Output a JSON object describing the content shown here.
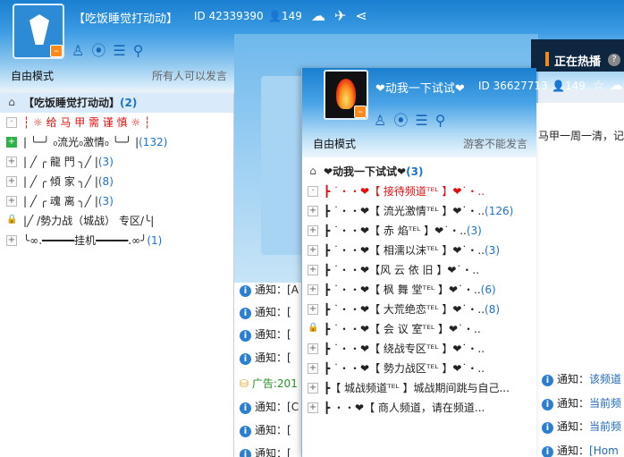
{
  "bg_channel": {
    "title": "【吃饭睡觉打动动】",
    "id_text": "ID 42339390",
    "member_count": "149",
    "mode_label": "自由模式",
    "speak_note": "所有人可以发言",
    "channels": [
      {
        "label": "【吃饭睡觉打动动】",
        "count": "(2)",
        "icon": "home",
        "style": "sel bold"
      },
      {
        "label": "┆ ☼  给 马 甲 需 谨 慎  ☼ ┆",
        "count": "",
        "icon": "dot",
        "style": "red"
      },
      {
        "label": "| ╰─╯ ₀流光₀激情₀ ╰─╯ |",
        "count": "(132)",
        "icon": "green",
        "style": ""
      },
      {
        "label": "| ╱ ╭ 龍        門 ╮╱  |",
        "count": "(3)",
        "icon": "plus",
        "style": ""
      },
      {
        "label": "| ╱ ╭ 傾        家 ╮╱  |",
        "count": "(8)",
        "icon": "plus",
        "style": ""
      },
      {
        "label": "| ╱ ╭ 魂        离 ╮╱  |",
        "count": "(3)",
        "icon": "plus",
        "style": ""
      },
      {
        "label": "|╱ /勢力战（城战） 专区/╰|",
        "count": "",
        "icon": "lock",
        "style": ""
      },
      {
        "label": "╰∞.━━━━━挂机━━━━━.∞╯",
        "count": "(1)",
        "icon": "plus",
        "style": ""
      }
    ],
    "chat_lines": [
      {
        "prefix": "通知：",
        "text": "[A"
      },
      {
        "prefix": "通知：",
        "text": "["
      },
      {
        "prefix": "通知：",
        "text": "["
      },
      {
        "prefix": "通知：",
        "text": "["
      },
      {
        "prefix": "广告:",
        "text": "201"
      },
      {
        "prefix": "通知：",
        "text": "[C"
      },
      {
        "prefix": "通知：",
        "text": "["
      },
      {
        "prefix": "通知：",
        "text": "["
      }
    ],
    "hot_label": "正在热播",
    "hot_help": "?",
    "right_text": "马甲一周一清，记",
    "right_lines": [
      {
        "prefix": "通知：",
        "text": "该频道"
      },
      {
        "prefix": "通知：",
        "text": "当前频"
      },
      {
        "prefix": "通知：",
        "text": "当前频"
      },
      {
        "prefix": "通知：",
        "text": "[Hom"
      }
    ]
  },
  "fg_channel": {
    "title": "❤动我一下试试❤",
    "id_text": "ID 36627713",
    "member_count": "149",
    "mode_label": "自由模式",
    "speak_note": "游客不能发言",
    "channels": [
      {
        "label": "❤动我一下试试❤",
        "count": "(3)",
        "icon": "home",
        "style": "bold"
      },
      {
        "label": "┣  ˙・・❤【 接待频道ᵀᴱᴸ 】❤˙・..",
        "count": "",
        "icon": "dot",
        "style": "red"
      },
      {
        "label": "┣  ˙・・❤【 流光激情ᵀᴱᴸ 】❤˙・..",
        "count": "(126)",
        "icon": "plus",
        "style": ""
      },
      {
        "label": "┣  ˙・・❤【 赤    焰ᵀᴱᴸ 】❤˙・..",
        "count": "(3)",
        "icon": "plus",
        "style": ""
      },
      {
        "label": "┣  ˙・・❤【 相濡以沫ᵀᴱᴸ 】❤˙・..",
        "count": "(3)",
        "icon": "plus",
        "style": ""
      },
      {
        "label": "┣  ˙・・❤【风 云 依 旧 】❤˙・..",
        "count": "",
        "icon": "plus",
        "style": ""
      },
      {
        "label": "┣  ˙・・❤【 枫 舞 堂ᵀᴱᴸ 】❤˙・..",
        "count": "(6)",
        "icon": "plus",
        "style": ""
      },
      {
        "label": "┣  ˙・・❤【 大荒绝恋ᵀᴱᴸ 】❤˙・..",
        "count": "(8)",
        "icon": "plus",
        "style": ""
      },
      {
        "label": "┣  ˙・・❤【 会 议 室ᵀᴱᴸ 】❤˙・..",
        "count": "",
        "icon": "lock",
        "style": ""
      },
      {
        "label": "┣  ˙・・❤【 绕战专区ᵀᴱᴸ 】❤˙・..",
        "count": "",
        "icon": "plus",
        "style": ""
      },
      {
        "label": "┣  ˙・・❤【 勢力战区ᵀᴱᴸ 】❤˙・..",
        "count": "",
        "icon": "plus",
        "style": ""
      },
      {
        "label": "┣【 城战频道ᵀᴱᴸ 】城战期间跳与自己...",
        "count": "",
        "icon": "plus",
        "style": ""
      },
      {
        "label": "┣    ・・❤【 商人频道，请在频道...",
        "count": "",
        "icon": "plus",
        "style": ""
      }
    ]
  },
  "colors": {
    "accent": "#1a7fd0",
    "count_blue": "#1a72c9",
    "red_channel": "#e01010",
    "badge_orange": "#ff8a1a"
  }
}
